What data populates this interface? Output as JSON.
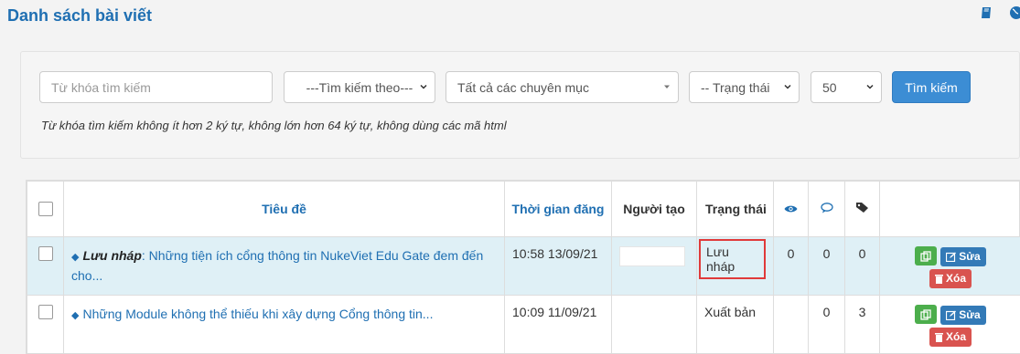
{
  "header": {
    "title": "Danh sách bài viết",
    "icons": [
      "book-icon",
      "globe-icon"
    ]
  },
  "search": {
    "keyword_placeholder": "Từ khóa tìm kiếm",
    "search_by": "---Tìm kiếm theo---",
    "category": "Tất cả các chuyên mục",
    "status": "-- Trạng thái",
    "per_page": "50",
    "button_label": "Tìm kiếm",
    "hint": "Từ khóa tìm kiếm không ít hơn 2 ký tự, không lớn hơn 64 ký tự, không dùng các mã html"
  },
  "table": {
    "headers": {
      "title": "Tiêu đề",
      "publish_time": "Thời gian đăng",
      "author": "Người tạo",
      "status": "Trạng thái",
      "views_icon": "eye-icon",
      "comments_icon": "comment-icon",
      "tags_icon": "tags-icon"
    },
    "rows": [
      {
        "draft_prefix": "Lưu nháp",
        "title": ": Những tiện ích cổng thông tin NukeViet Edu Gate đem đến cho...",
        "time": "10:58 13/09/21",
        "author": "",
        "status": "Lưu nháp",
        "views": "0",
        "comments": "0",
        "tags": "0"
      },
      {
        "draft_prefix": "",
        "title": "Những Module không thể thiếu khi xây dựng Cổng thông tin...",
        "time": "10:09 11/09/21",
        "author": "",
        "status": "Xuất bản",
        "views": "",
        "comments": "0",
        "tags": "3"
      }
    ],
    "actions": {
      "edit_label": "Sửa",
      "delete_label": "Xóa"
    }
  },
  "colors": {
    "accent": "#1f6fb2",
    "button_primary": "#3c8dd4",
    "copy": "#4cae4c",
    "edit": "#337ab7",
    "delete": "#d9534f",
    "highlight_row": "#dff0f6",
    "callout": "#e03a3a"
  }
}
